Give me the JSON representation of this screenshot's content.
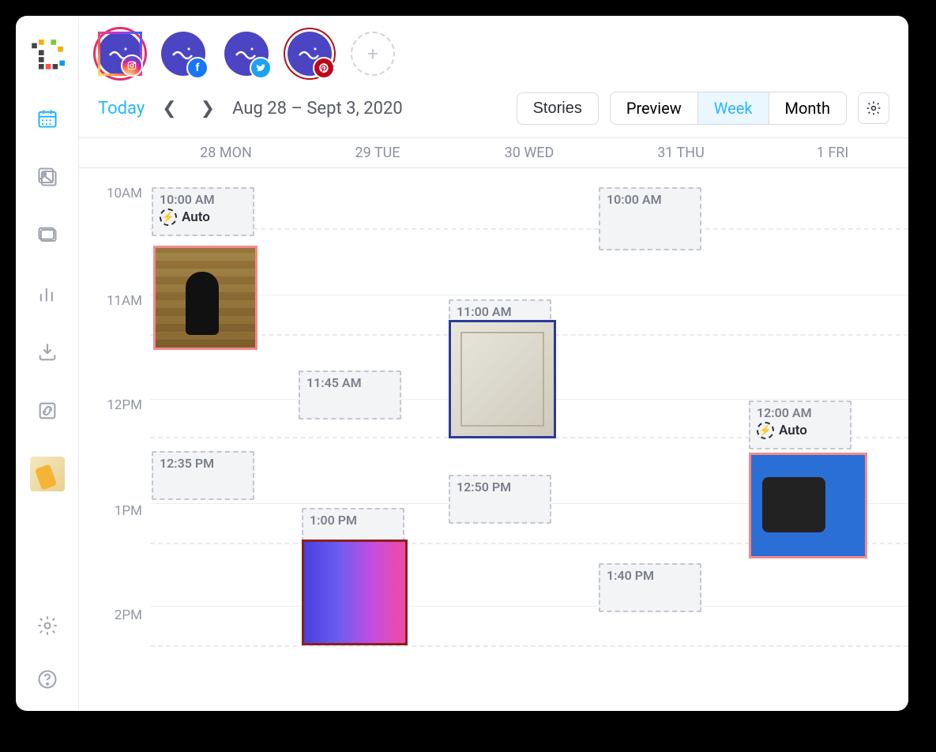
{
  "toolbar": {
    "today": "Today",
    "range": "Aug 28 – Sept 3, 2020",
    "stories": "Stories",
    "preview": "Preview",
    "week": "Week",
    "month": "Month"
  },
  "accounts": [
    {
      "network": "instagram"
    },
    {
      "network": "facebook"
    },
    {
      "network": "twitter"
    },
    {
      "network": "pinterest"
    }
  ],
  "days": [
    "28 MON",
    "29 TUE",
    "30 WED",
    "31 THU",
    "1 FRI"
  ],
  "hours": [
    "10AM",
    "11AM",
    "12PM",
    "1PM",
    "2PM"
  ],
  "slots": {
    "mon_1000": "10:00 AM",
    "mon_1000_auto": "Auto",
    "tue_1145": "11:45 AM",
    "wed_1100": "11:00 AM",
    "thu_1000": "10:00 AM",
    "mon_1235": "12:35 PM",
    "wed_1250": "12:50 PM",
    "tue_1300": "1:00 PM",
    "thu_1340": "1:40 PM",
    "fri_1200": "12:00 AM",
    "fri_1200_auto": "Auto"
  }
}
